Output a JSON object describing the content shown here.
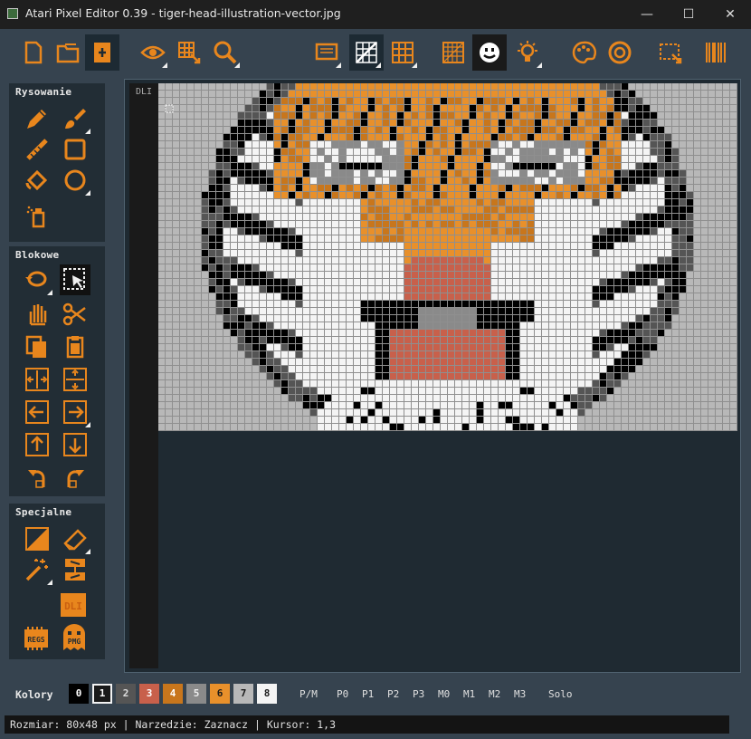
{
  "window": {
    "title": "Atari Pixel Editor 0.39 - tiger-head-illustration-vector.jpg",
    "minimize": "—",
    "maximize": "☐",
    "close": "✕"
  },
  "toolbar": {
    "buttons": [
      {
        "icon": "new-file-icon"
      },
      {
        "icon": "open-folder-icon"
      },
      {
        "icon": "save-file-icon",
        "active": true
      },
      {
        "icon": "eye-icon"
      },
      {
        "icon": "grid-select-icon"
      },
      {
        "icon": "magnifier-icon"
      },
      {
        "icon": "monitor-icon"
      },
      {
        "icon": "grid-diagonal-icon",
        "active": true
      },
      {
        "icon": "grid-icon"
      },
      {
        "icon": "pattern-icon"
      },
      {
        "icon": "smiley-icon",
        "active": true
      },
      {
        "icon": "lightbulb-icon"
      },
      {
        "icon": "palette-icon"
      },
      {
        "icon": "help-icon"
      },
      {
        "icon": "resize-icon"
      },
      {
        "icon": "barcode-icon"
      }
    ]
  },
  "panels": {
    "drawing": {
      "title": "Rysowanie"
    },
    "block": {
      "title": "Blokowe"
    },
    "special": {
      "title": "Specjalne",
      "dli_label": "DLI",
      "regs_label": "REGS",
      "pmg_label": "PMG"
    }
  },
  "canvas": {
    "dli_label": "DLI",
    "size_label": "80x48"
  },
  "colors": {
    "label": "Kolory",
    "selected_index": 1,
    "swatches": [
      {
        "label": "0",
        "hex": "#000000",
        "text": "#ffffff"
      },
      {
        "label": "1",
        "hex": "#1a1a1a",
        "text": "#ffffff"
      },
      {
        "label": "2",
        "hex": "#555555",
        "text": "#dddddd"
      },
      {
        "label": "3",
        "hex": "#c8604b",
        "text": "#ffffff"
      },
      {
        "label": "4",
        "hex": "#c8761c",
        "text": "#ffffff"
      },
      {
        "label": "5",
        "hex": "#8a8a8a",
        "text": "#eeeeee"
      },
      {
        "label": "6",
        "hex": "#e8902b",
        "text": "#1a1a1a"
      },
      {
        "label": "7",
        "hex": "#b8b8b8",
        "text": "#1a1a1a"
      },
      {
        "label": "8",
        "hex": "#f4f4f4",
        "text": "#1a1a1a"
      }
    ],
    "players": [
      "P/M",
      "P0",
      "P1",
      "P2",
      "P3",
      "M0",
      "M1",
      "M2",
      "M3",
      "Solo"
    ]
  },
  "status": {
    "text": "Rozmiar: 80x48 px | Narzedzie: Zaznacz | Kursor: 1,3"
  },
  "theme": {
    "accent": "#e8861d",
    "background": "#36434f",
    "panel": "#222d35"
  }
}
